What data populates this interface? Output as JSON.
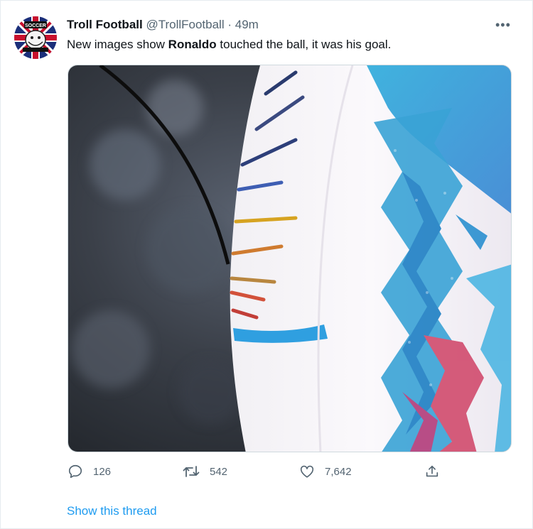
{
  "tweet": {
    "author_name": "Troll Football",
    "handle": "@TrollFootball",
    "separator": "·",
    "time": "49m",
    "text_before": "New images show ",
    "text_bold": "Ronaldo",
    "text_after": " touched the ball, it was his goal.",
    "avatar_text": "SOCCER",
    "more_icon": "more-horizontal-icon"
  },
  "actions": {
    "reply_count": "126",
    "retweet_count": "542",
    "like_count": "7,642"
  },
  "thread": {
    "show_label": "Show this thread"
  },
  "colors": {
    "link": "#1d9bf0",
    "text": "#0f1419",
    "secondary": "#536471"
  }
}
